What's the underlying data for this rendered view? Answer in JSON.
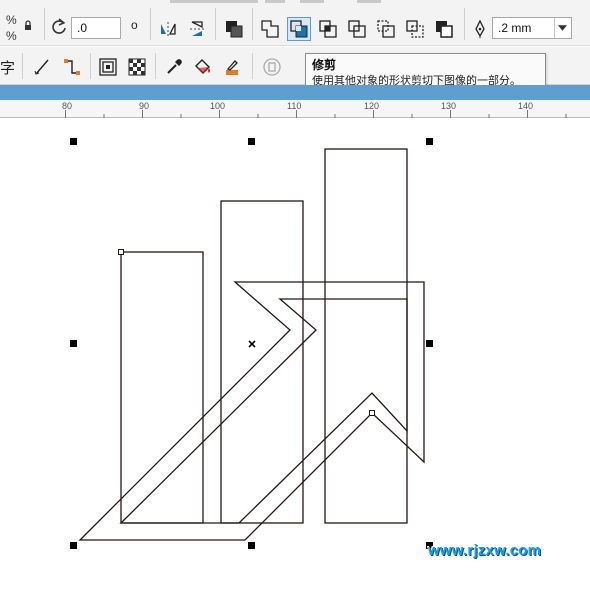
{
  "property_bar": {
    "percent_top": "%",
    "percent_bottom": "%",
    "rotation_value": ".0",
    "rotation_unit": "o",
    "outline_width": ".2 mm"
  },
  "toolbar2": {
    "text_tool_fragment": "字"
  },
  "tooltip": {
    "title": "修剪",
    "description": "使用其他对象的形状剪切下图像的一部分。"
  },
  "ruler": {
    "labels": [
      "80",
      "90",
      "100",
      "110",
      "120",
      "130",
      "140"
    ]
  },
  "watermark": "www.rjzxw.com",
  "colors": {
    "accent_blue": "#5f9fd0",
    "active_button": "#5b9bd5",
    "watermark": "#1fa0e6"
  }
}
